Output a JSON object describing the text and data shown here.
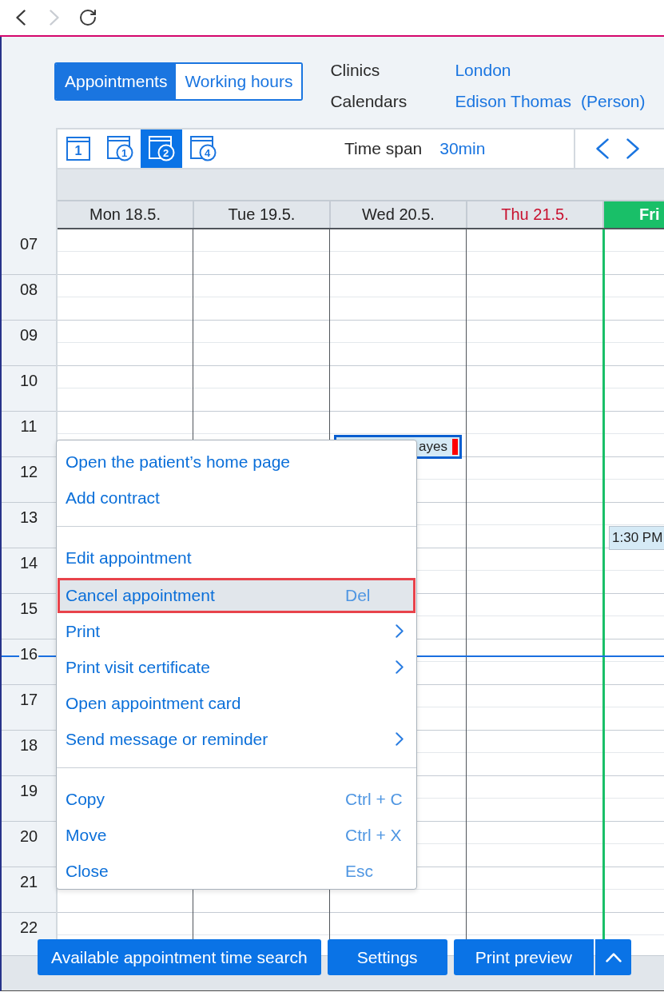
{
  "browser": {
    "back": {
      "disabled": false
    },
    "forward": {
      "disabled": true
    }
  },
  "mode_tabs": [
    {
      "label": "Appointments",
      "selected": true
    },
    {
      "label": "Working hours",
      "selected": false
    }
  ],
  "filters": [
    {
      "label": "Clinics",
      "value": "London"
    },
    {
      "label": "Calendars",
      "value": "Edison Thomas",
      "note": "(Person)"
    }
  ],
  "toolbar": {
    "views": [
      {
        "kind": "plain",
        "number": "1",
        "selected": false
      },
      {
        "kind": "circled",
        "number": "1",
        "selected": false
      },
      {
        "kind": "circled",
        "number": "2",
        "selected": true
      },
      {
        "kind": "circled",
        "number": "4",
        "selected": false
      }
    ],
    "time_span": {
      "label": "Time span",
      "value": "30min"
    }
  },
  "calendar": {
    "days": [
      {
        "label": "Mon 18.5.",
        "holiday": false,
        "today": false
      },
      {
        "label": "Tue 19.5.",
        "holiday": false,
        "today": false
      },
      {
        "label": "Wed 20.5.",
        "holiday": false,
        "today": false,
        "appointments": [
          {
            "label": "ayes",
            "selected": true,
            "color": "#ff0000"
          }
        ]
      },
      {
        "label": "Thu 21.5.",
        "holiday": true,
        "today": false
      },
      {
        "label": "Fri",
        "holiday": false,
        "today": true,
        "appointments": [
          {
            "label": "1:30 PM",
            "selected": false
          }
        ]
      }
    ],
    "hours": [
      "07",
      "08",
      "09",
      "10",
      "11",
      "12",
      "13",
      "14",
      "15",
      "16",
      "17",
      "18",
      "19",
      "20",
      "21",
      "22"
    ]
  },
  "context_menu": {
    "groups": [
      {
        "items": [
          {
            "label": "Open the patient’s home page",
            "submenu": false,
            "selected": false
          },
          {
            "label": "Add contract",
            "submenu": false,
            "selected": false
          }
        ]
      },
      {
        "items": [
          {
            "label": "Edit appointment",
            "submenu": false,
            "selected": false
          },
          {
            "label": "Cancel appointment",
            "shortcut": "Del",
            "submenu": false,
            "selected": true
          },
          {
            "label": "Print",
            "submenu": true,
            "selected": false
          },
          {
            "label": "Print visit certificate",
            "submenu": true,
            "selected": false
          },
          {
            "label": "Open appointment card",
            "submenu": false,
            "selected": false
          },
          {
            "label": "Send message or reminder",
            "submenu": true,
            "selected": false
          }
        ]
      },
      {
        "items": [
          {
            "label": "Copy",
            "shortcut": "Ctrl + C",
            "submenu": false,
            "selected": false
          },
          {
            "label": "Move",
            "shortcut": "Ctrl + X",
            "submenu": false,
            "selected": false
          },
          {
            "label": "Close",
            "shortcut": "Esc",
            "submenu": false,
            "selected": false
          }
        ]
      }
    ]
  },
  "footer_buttons": [
    {
      "label": "Available appointment time search",
      "kind": "plain"
    },
    {
      "label": "Settings",
      "kind": "plain"
    },
    {
      "label": "Print preview",
      "kind": "split"
    }
  ]
}
